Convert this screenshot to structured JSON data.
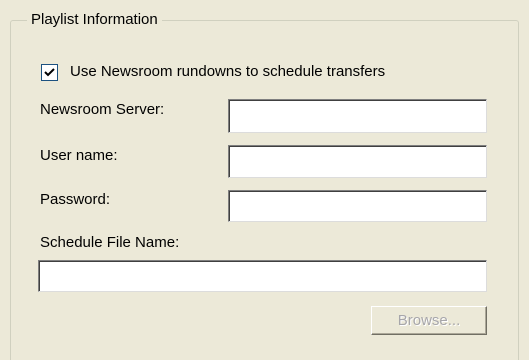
{
  "group": {
    "title": "Playlist Information"
  },
  "checkbox": {
    "label": "Use Newsroom rundowns to schedule transfers",
    "checked": true
  },
  "fields": {
    "server": {
      "label": "Newsroom Server:",
      "value": ""
    },
    "username": {
      "label": "User name:",
      "value": ""
    },
    "password": {
      "label": "Password:",
      "value": ""
    },
    "schedule_file": {
      "label": "Schedule File Name:",
      "value": ""
    }
  },
  "buttons": {
    "browse_label": "Browse...",
    "browse_enabled": false
  },
  "colors": {
    "dialog_background": "#ece9d8",
    "groupbox_border": "#d0d0bf",
    "checkbox_border": "#1c5180",
    "disabled_text": "#a7a6aa"
  },
  "icons": {
    "checkmark": "checkmark-icon"
  }
}
